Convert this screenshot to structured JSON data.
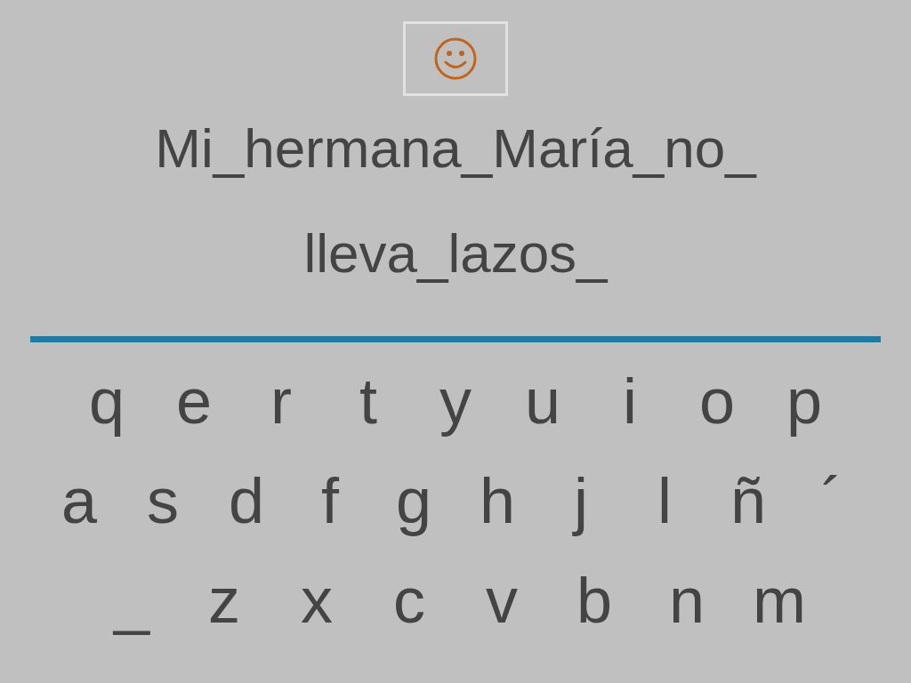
{
  "sentence": [
    "Mi_hermana_María_no_",
    "lleva_lazos_"
  ],
  "keyboard": [
    [
      "q",
      "e",
      "r",
      "t",
      "y",
      "u",
      "i",
      "o",
      "p"
    ],
    [
      "a",
      "s",
      "d",
      "f",
      "g",
      "h",
      "j",
      "l",
      "ñ",
      "´"
    ],
    [
      "_",
      "z",
      "x",
      "c",
      "v",
      "b",
      "n",
      "m"
    ]
  ]
}
